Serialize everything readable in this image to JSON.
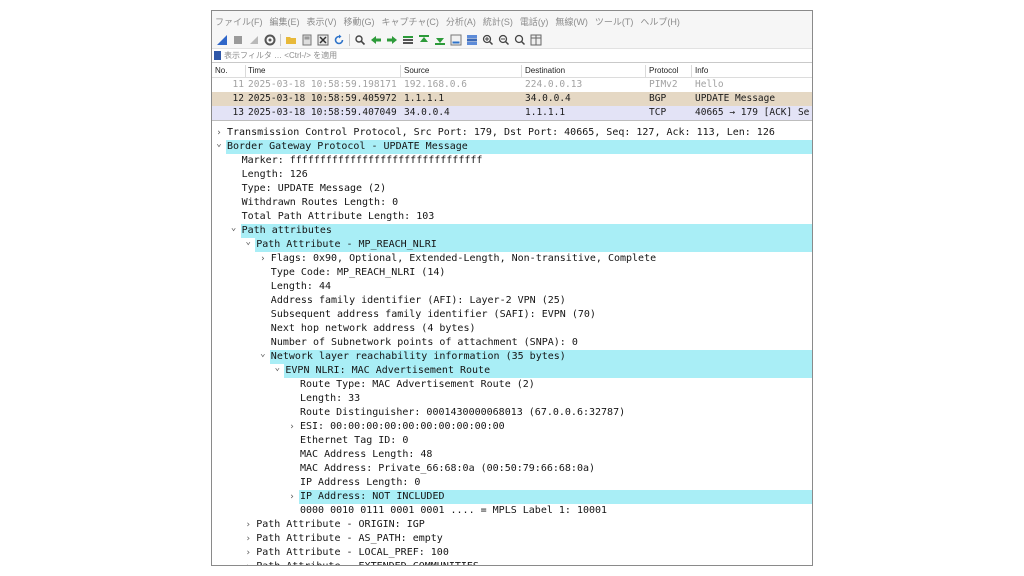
{
  "menu": [
    "ファイル(F)",
    "編集(E)",
    "表示(V)",
    "移動(G)",
    "キャプチャ(C)",
    "分析(A)",
    "統計(S)",
    "電話(y)",
    "無線(W)",
    "ツール(T)",
    "ヘルプ(H)"
  ],
  "filter": {
    "placeholder": "表示フィルタ … <Ctrl-/> を適用"
  },
  "packet_list": {
    "headers": {
      "no": "No.",
      "time": "Time",
      "source": "Source",
      "destination": "Destination",
      "protocol": "Protocol",
      "info": "Info"
    },
    "rows": [
      {
        "no": "11",
        "time": "2025-03-18 10:58:59.198171",
        "source": "192.168.0.6",
        "destination": "224.0.0.13",
        "protocol": "PIMv2",
        "info": "Hello"
      },
      {
        "no": "12",
        "time": "2025-03-18 10:58:59.405972",
        "source": "1.1.1.1",
        "destination": "34.0.0.4",
        "protocol": "BGP",
        "info": "UPDATE Message"
      },
      {
        "no": "13",
        "time": "2025-03-18 10:58:59.407049",
        "source": "34.0.0.4",
        "destination": "1.1.1.1",
        "protocol": "TCP",
        "info": "40665 → 179 [ACK] Se"
      }
    ]
  },
  "details": [
    {
      "text": "Transmission Control Protocol, Src Port: 179, Dst Port: 40665, Seq: 127, Ack: 113, Len: 126",
      "toggle": "collapsed",
      "highlight": false
    },
    {
      "text": "Border Gateway Protocol - UPDATE Message",
      "toggle": "expanded",
      "highlight": true
    },
    {
      "text": "Marker: ffffffffffffffffffffffffffffffff",
      "toggle": "none",
      "highlight": false
    },
    {
      "text": "Length: 126",
      "toggle": "none",
      "highlight": false
    },
    {
      "text": "Type: UPDATE Message (2)",
      "toggle": "none",
      "highlight": false
    },
    {
      "text": "Withdrawn Routes Length: 0",
      "toggle": "none",
      "highlight": false
    },
    {
      "text": "Total Path Attribute Length: 103",
      "toggle": "none",
      "highlight": false
    },
    {
      "text": "Path attributes",
      "toggle": "expanded",
      "highlight": true
    },
    {
      "text": "Path Attribute - MP_REACH_NLRI",
      "toggle": "expanded",
      "highlight": true
    },
    {
      "text": "Flags: 0x90, Optional, Extended-Length, Non-transitive, Complete",
      "toggle": "collapsed",
      "highlight": false
    },
    {
      "text": "Type Code: MP_REACH_NLRI (14)",
      "toggle": "none",
      "highlight": false
    },
    {
      "text": "Length: 44",
      "toggle": "none",
      "highlight": false
    },
    {
      "text": "Address family identifier (AFI): Layer-2 VPN (25)",
      "toggle": "none",
      "highlight": false
    },
    {
      "text": "Subsequent address family identifier (SAFI): EVPN (70)",
      "toggle": "none",
      "highlight": false
    },
    {
      "text": "Next hop network address (4 bytes)",
      "toggle": "none",
      "highlight": false
    },
    {
      "text": "Number of Subnetwork points of attachment (SNPA): 0",
      "toggle": "none",
      "highlight": false
    },
    {
      "text": "Network layer reachability information (35 bytes)",
      "toggle": "expanded",
      "highlight": true
    },
    {
      "text": "EVPN NLRI: MAC Advertisement Route",
      "toggle": "expanded",
      "highlight": true
    },
    {
      "text": "Route Type: MAC Advertisement Route (2)",
      "toggle": "none",
      "highlight": false
    },
    {
      "text": "Length: 33",
      "toggle": "none",
      "highlight": false
    },
    {
      "text": "Route Distinguisher: 0001430000068013 (67.0.0.6:32787)",
      "toggle": "none",
      "highlight": false
    },
    {
      "text": "ESI: 00:00:00:00:00:00:00:00:00:00",
      "toggle": "collapsed",
      "highlight": false
    },
    {
      "text": "Ethernet Tag ID: 0",
      "toggle": "none",
      "highlight": false
    },
    {
      "text": "MAC Address Length: 48",
      "toggle": "none",
      "highlight": false
    },
    {
      "text": "MAC Address: Private_66:68:0a (00:50:79:66:68:0a)",
      "toggle": "none",
      "highlight": false
    },
    {
      "text": "IP Address Length: 0",
      "toggle": "none",
      "highlight": false
    },
    {
      "text": "IP Address: NOT INCLUDED",
      "toggle": "collapsed",
      "highlight": true
    },
    {
      "text": "0000 0010 0111 0001 0001 .... = MPLS Label 1: 10001",
      "toggle": "none",
      "highlight": false
    },
    {
      "text": "Path Attribute - ORIGIN: IGP",
      "toggle": "collapsed",
      "highlight": false
    },
    {
      "text": "Path Attribute - AS_PATH: empty",
      "toggle": "collapsed",
      "highlight": false
    },
    {
      "text": "Path Attribute - LOCAL_PREF: 100",
      "toggle": "collapsed",
      "highlight": false
    },
    {
      "text": "Path Attribute - EXTENDED_COMMUNITIES",
      "toggle": "collapsed",
      "highlight": false
    }
  ],
  "colors": {
    "highlight": "#a9eef6",
    "row_selected": "#e5d8c4",
    "row_tcp": "#e3e3f6"
  }
}
